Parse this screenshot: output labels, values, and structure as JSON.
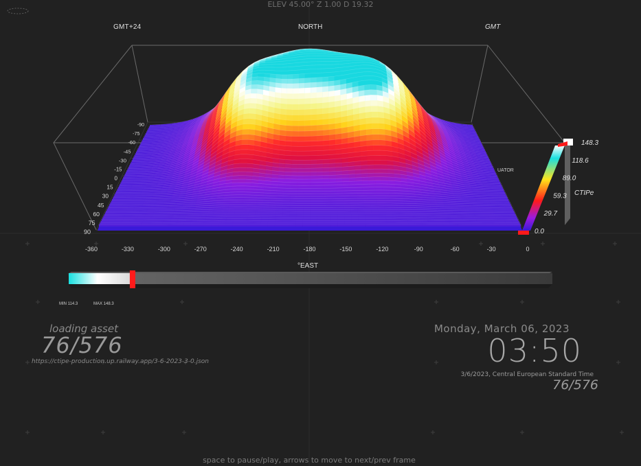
{
  "header": {
    "elevation_readout": "ELEV 45.00° Z 1.00 D 19.32"
  },
  "plot": {
    "corner_labels": {
      "left": "GMT+24",
      "center": "NORTH",
      "right": "GMT"
    },
    "equator_label": "UATOR",
    "x_axis_title": "°EAST",
    "x_ticks": [
      "-360",
      "-330",
      "-300",
      "-270",
      "-240",
      "-210",
      "-180",
      "-150",
      "-120",
      "-90",
      "-60",
      "-30",
      "0"
    ],
    "lat_ticks": [
      "-90",
      "-75",
      "-60",
      "-45",
      "-30",
      "-15",
      "0",
      "15",
      "30",
      "45",
      "60",
      "75",
      "90"
    ],
    "surface_colors": [
      "#3a1fd8",
      "#8b1de0",
      "#e01040",
      "#ff2a2a",
      "#ffd21a",
      "#f5f58a",
      "#ffffff",
      "#19d8e0"
    ]
  },
  "colorbar": {
    "variable_label": "CTIPe",
    "ticks": [
      "148.3",
      "118.6",
      "89.0",
      "59.3",
      "29.7",
      "0.0"
    ],
    "colors": [
      "#ffffff",
      "#19e0e0",
      "#ffe31a",
      "#ff1a1a",
      "#9a1ae0",
      "#3a1ad8"
    ]
  },
  "progress": {
    "fraction": 0.132,
    "min_label": "MIN 114.3",
    "max_label": "MAX 148.3"
  },
  "loading": {
    "title": "loading asset",
    "count": "76/576",
    "url": "https://ctipe-production.up.railway.app/3-6-2023-3-0.json"
  },
  "datetime": {
    "date": "Monday, March 06, 2023",
    "time": "03:50",
    "timezone_line": "3/6/2023, Central European Standard Time",
    "frame": "76/576"
  },
  "footer": {
    "hint": "space to pause/play, arrows to move to next/prev frame"
  }
}
